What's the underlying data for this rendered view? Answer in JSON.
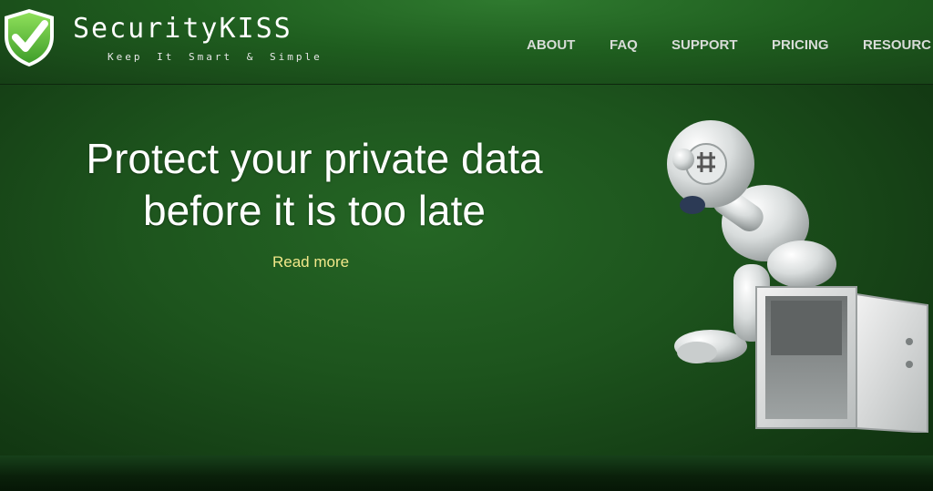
{
  "brand": {
    "name": "SecurityKISS",
    "tagline": "Keep It Smart & Simple"
  },
  "nav": {
    "items": [
      "ABOUT",
      "FAQ",
      "SUPPORT",
      "PRICING",
      "RESOURC"
    ]
  },
  "hero": {
    "headline_line1": "Protect your private data",
    "headline_line2": "before it is too late",
    "cta": "Read more"
  },
  "colors": {
    "header_green": "#1f5e1f",
    "hero_green": "#1d541d",
    "cta_yellow": "#f2e88a",
    "nav_text": "#d8dcd8"
  },
  "icons": {
    "logo": "shield-check-icon",
    "illustration": "robot-with-safe-illustration"
  }
}
